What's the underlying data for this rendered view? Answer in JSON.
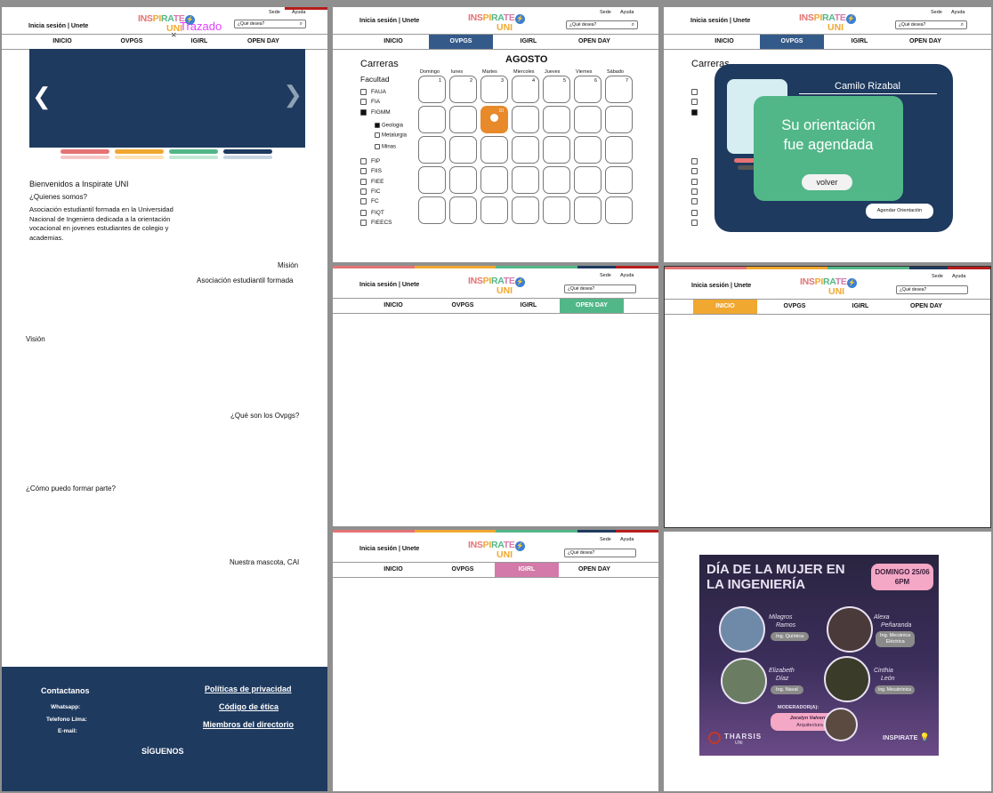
{
  "header": {
    "login": "Inicia sesión | Unete",
    "sede": "Sede",
    "ayuda": "Ayuda",
    "logo_top": "INSPIRATE",
    "logo_bottom": "UNI",
    "search_placeholder": "¿Qué desea?",
    "search_placeholder_alt": "¿Qué desea?",
    "overlay_word": "Trazado"
  },
  "nav": [
    "INICIO",
    "OVPGS",
    "IGIRL",
    "OPEN DAY"
  ],
  "colors": {
    "navy": "#1e3a5f",
    "orange": "#f0a830",
    "green": "#52b788",
    "pink": "#d47aaa",
    "red": "#b71c1c",
    "coral": "#e57373",
    "calendar_highlight": "#e8892a"
  },
  "home": {
    "welcome": "Bienvenidos a Inspirate UNI",
    "quienes": "¿Quienes somos?",
    "desc1": "Asociación estudiantil formada en la Universidad",
    "desc2": "Nacional de Ingeniera dedicada a la orientación",
    "desc3": "vocacional en jovenes estudiantes de colegio y",
    "desc4": "academias.",
    "mision": "Misión",
    "mision_text": "Asociación estudiantil formada",
    "vision": "Visión",
    "ovpgs_q": "¿Qué son los Ovpgs?",
    "formar": "¿Cómo puedo formar parte?",
    "mascota": "Nuestra mascota, CAI",
    "footer": {
      "contact": "Contactanos",
      "whatsapp": "Whatsapp:",
      "telefono": "Telefono Lima:",
      "email": "E-mail:",
      "siguenos": "SÍGUENOS",
      "privacy": "Políticas de privacidad",
      "ethics": "Código de ética",
      "members": "Miembros del directorio"
    }
  },
  "calendar": {
    "carreras": "Carreras",
    "facultad": "Facultad",
    "month": "AGOSTO",
    "days": [
      "Domingo",
      "lunes",
      "Martes",
      "Miercoles",
      "Jueves",
      "Viernes",
      "Sábado"
    ],
    "first_row": [
      "1",
      "2",
      "3",
      "4",
      "5",
      "6",
      "7"
    ],
    "faculties": [
      "FAUA",
      "FIA",
      "FIGMM",
      "FIP",
      "FIIS",
      "FIEE",
      "FIC",
      "FC",
      "FIQT",
      "FIEECS"
    ],
    "sub": [
      "Geologia",
      "Metalurgia",
      "Minas"
    ],
    "event_num": "10"
  },
  "modal": {
    "name": "Camilo Rizabal",
    "message1": "Su orientación",
    "message2": "fue agendada",
    "back": "volver",
    "schedule": "Agendar Orientación"
  },
  "poster": {
    "title1": "DÍA DE LA MUJER EN",
    "title2": "LA INGENIERÍA",
    "date1": "DOMINGO 25/06",
    "date2": "6PM",
    "p1_name1": "Milagros",
    "p1_name2": "Ramos",
    "p1_role": "Ing. Química",
    "p2_name1": "Alexa",
    "p2_name2": "Peñaranda",
    "p2_role1": "Ing. Mecánica",
    "p2_role2": "Eléctrica",
    "p3_name1": "Elizabeth",
    "p3_name2": "Díaz",
    "p3_role": "Ing. Naval",
    "p4_name1": "Cinthia",
    "p4_name2": "León",
    "p4_role": "Ing. Mecatrónica",
    "moderator": "MODERADOR(A):",
    "mod_name": "Jocelyn Valverde",
    "mod_role": "Arquitectura",
    "org1": "THARSIS",
    "org1_sub": "UNI",
    "org2": "INSPIRATE"
  }
}
